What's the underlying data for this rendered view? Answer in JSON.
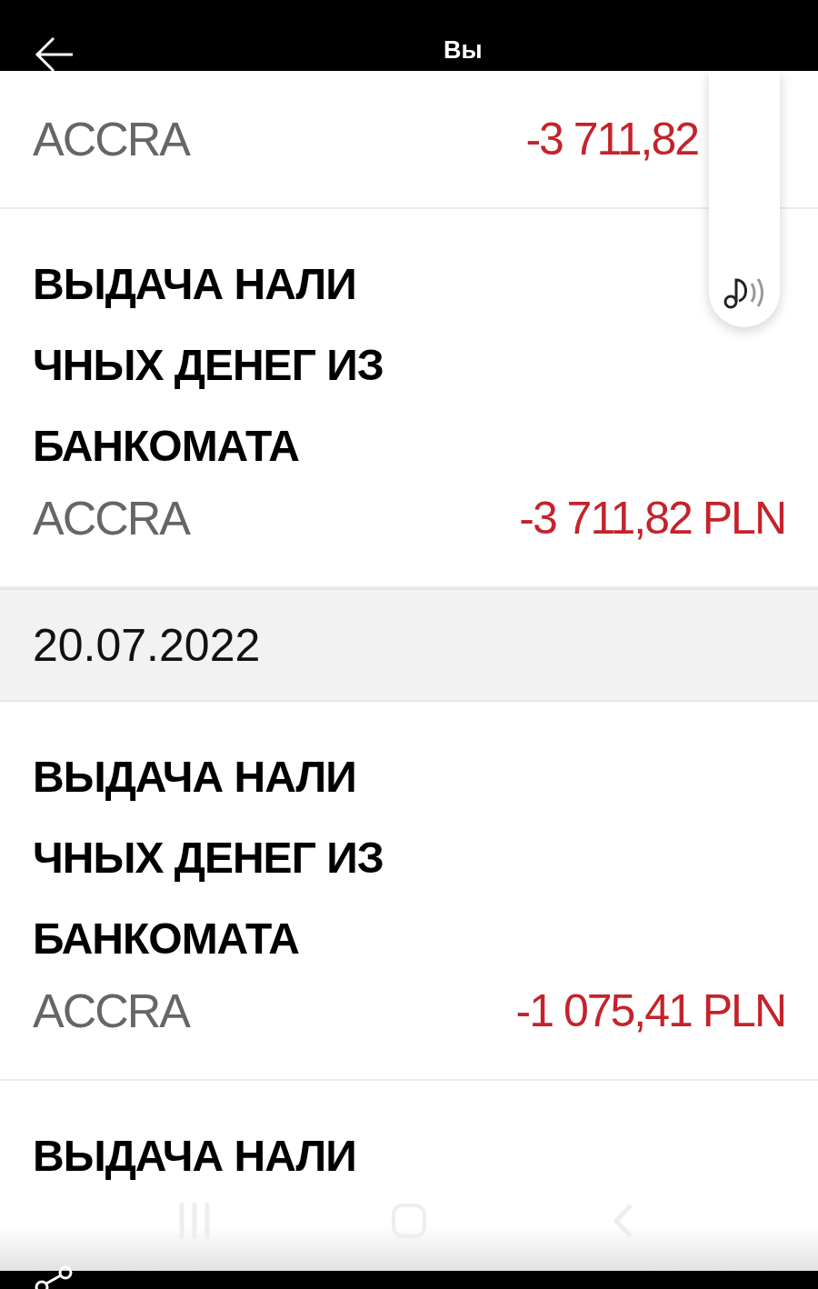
{
  "header": {
    "title": "Вы"
  },
  "items": [
    {
      "kind": "transaction",
      "merchant": "ACCRA",
      "amount": "-3 711,82"
    },
    {
      "kind": "transaction",
      "title_lines": [
        "ВЫДАЧА НАЛИ",
        "ЧНЫХ ДЕНЕГ ИЗ",
        "БАНКОМАТА"
      ],
      "merchant": "ACCRA",
      "amount": "-3 711,82 PLN"
    },
    {
      "kind": "date",
      "label": "20.07.2022"
    },
    {
      "kind": "transaction",
      "title_lines": [
        "ВЫДАЧА НАЛИ",
        "ЧНЫХ ДЕНЕГ ИЗ",
        "БАНКОМАТА"
      ],
      "merchant": "ACCRA",
      "amount": "-1 075,41 PLN"
    },
    {
      "kind": "transaction",
      "title_lines": [
        "ВЫДАЧА НАЛИ"
      ]
    }
  ]
}
